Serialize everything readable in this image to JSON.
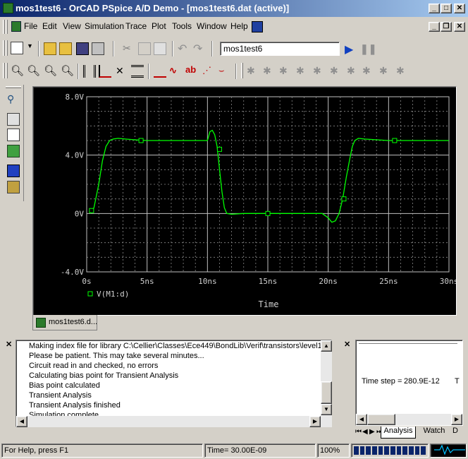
{
  "window": {
    "title": "mos1test6 - OrCAD PSpice A/D Demo  - [mos1test6.dat (active)]"
  },
  "menu": [
    "File",
    "Edit",
    "View",
    "Simulation",
    "Trace",
    "Plot",
    "Tools",
    "Window",
    "Help"
  ],
  "toolbar": {
    "profile_value": "mos1test6"
  },
  "chart_data": {
    "type": "line",
    "x_unit": "ns",
    "xlim": [
      0,
      30
    ],
    "ylim": [
      -4,
      8
    ],
    "xticks": [
      "0s",
      "5ns",
      "10ns",
      "15ns",
      "20ns",
      "25ns",
      "30ns"
    ],
    "yticks": [
      "8.0V",
      "4.0V",
      "0V",
      "-4.0V"
    ],
    "xlabel": "Time",
    "legend": "V(M1:d)",
    "series": [
      {
        "name": "V(M1:d)",
        "color": "#00ff00",
        "x": [
          0.3,
          0.6,
          1.0,
          1.3,
          1.6,
          1.9,
          2.2,
          2.6,
          3.2,
          4.0,
          5.0,
          8.0,
          10.0,
          10.2,
          10.4,
          10.6,
          10.8,
          11.0,
          11.2,
          11.4,
          11.6,
          12.0,
          13.0,
          15.0,
          18.0,
          19.5,
          20.0,
          20.3,
          20.6,
          20.9,
          21.2,
          21.5,
          21.8,
          22.0,
          22.2,
          22.5,
          23.0,
          25.0,
          30.0
        ],
        "y": [
          0.0,
          0.4,
          2.0,
          3.6,
          4.6,
          5.0,
          5.1,
          5.15,
          5.1,
          5.05,
          5.0,
          5.0,
          5.0,
          5.6,
          5.7,
          5.4,
          4.6,
          3.0,
          1.5,
          0.4,
          0.0,
          -0.05,
          0.0,
          0.0,
          0.0,
          0.0,
          -0.3,
          -0.6,
          -0.5,
          0.0,
          1.0,
          2.5,
          3.8,
          4.6,
          5.0,
          5.15,
          5.1,
          5.0,
          5.0
        ]
      }
    ],
    "markers": [
      {
        "x": 0.4,
        "y": 0.2
      },
      {
        "x": 4.5,
        "y": 5.0
      },
      {
        "x": 11.0,
        "y": 4.4
      },
      {
        "x": 15.0,
        "y": 0.0
      },
      {
        "x": 21.3,
        "y": 1.0
      },
      {
        "x": 25.5,
        "y": 5.0
      }
    ]
  },
  "plot_tab": {
    "label": "mos1test6.d..."
  },
  "output": {
    "lines": [
      "Making index file for library C:\\Cellier\\Classes\\Ece449\\BondLib\\Verif\\transistors\\level1\\",
      "Please be patient. This may take several minutes...",
      "Circuit read in and checked, no errors",
      "Calculating bias point for Transient Analysis",
      "Bias point calculated",
      "Transient Analysis",
      "Transient Analysis finished",
      "Simulation complete"
    ]
  },
  "watch": {
    "time_step_label": "Time step =",
    "time_step_value": "280.9E-12",
    "extra": "T",
    "tabs": [
      "Analysis",
      "Watch",
      "D"
    ]
  },
  "status": {
    "help": "For Help, press F1",
    "time": "Time= 30.00E-09",
    "zoom": "100%"
  }
}
